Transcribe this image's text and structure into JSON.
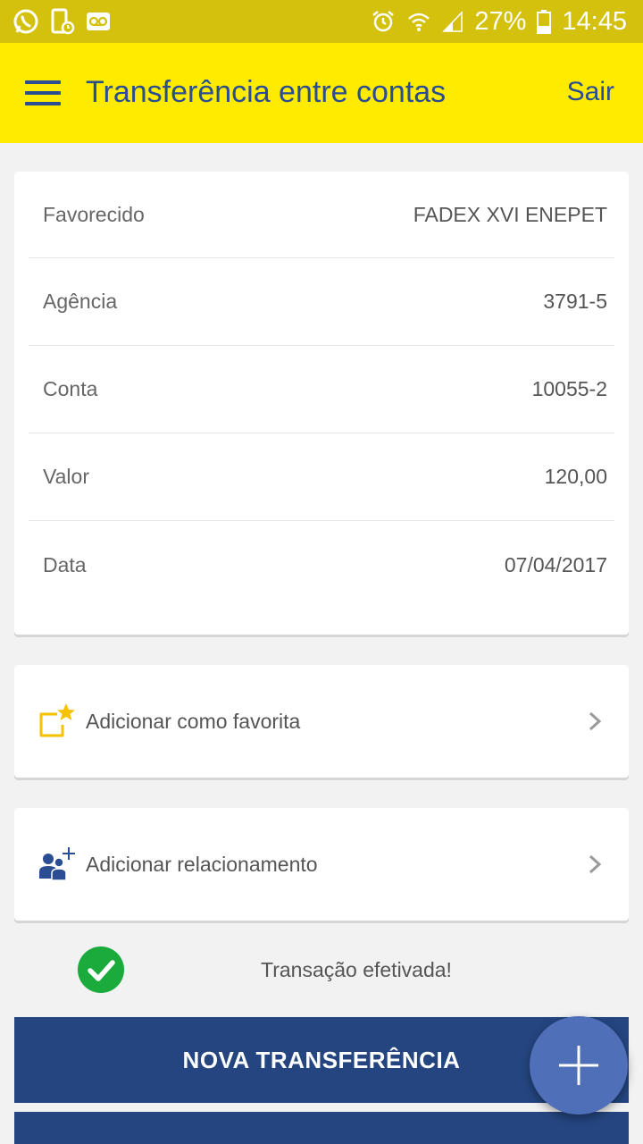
{
  "status_bar": {
    "battery": "27%",
    "time": "14:45",
    "icons": [
      "whatsapp-icon",
      "phone-clock-icon",
      "voicemail-icon",
      "alarm-icon",
      "wifi-icon",
      "signal-icon",
      "battery-icon"
    ]
  },
  "app_bar": {
    "title": "Transferência entre contas",
    "logout_label": "Sair",
    "menu_icon": "hamburger-menu-icon"
  },
  "details": {
    "rows": [
      {
        "label": "Favorecido",
        "value": "FADEX XVI ENEPET"
      },
      {
        "label": "Agência",
        "value": "3791-5"
      },
      {
        "label": "Conta",
        "value": "10055-2"
      },
      {
        "label": "Valor",
        "value": "120,00"
      },
      {
        "label": "Data",
        "value": "07/04/2017"
      }
    ]
  },
  "actions": {
    "favorite": {
      "label": "Adicionar como favorita",
      "icon": "favorite-star-icon"
    },
    "relationship": {
      "label": "Adicionar relacionamento",
      "icon": "add-person-icon"
    }
  },
  "success": {
    "message": "Transação efetivada!",
    "icon": "check-circle-icon"
  },
  "buttons": {
    "new_transfer": "NOVA TRANSFERÊNCIA"
  },
  "colors": {
    "status_bar": "#d4c10e",
    "app_bar": "#ffeb00",
    "primary_blue": "#24457f",
    "accent_blue": "#2a4e91",
    "fab": "#4f6fb8",
    "success_green": "#1aab3c",
    "star_yellow": "#f6c200"
  }
}
